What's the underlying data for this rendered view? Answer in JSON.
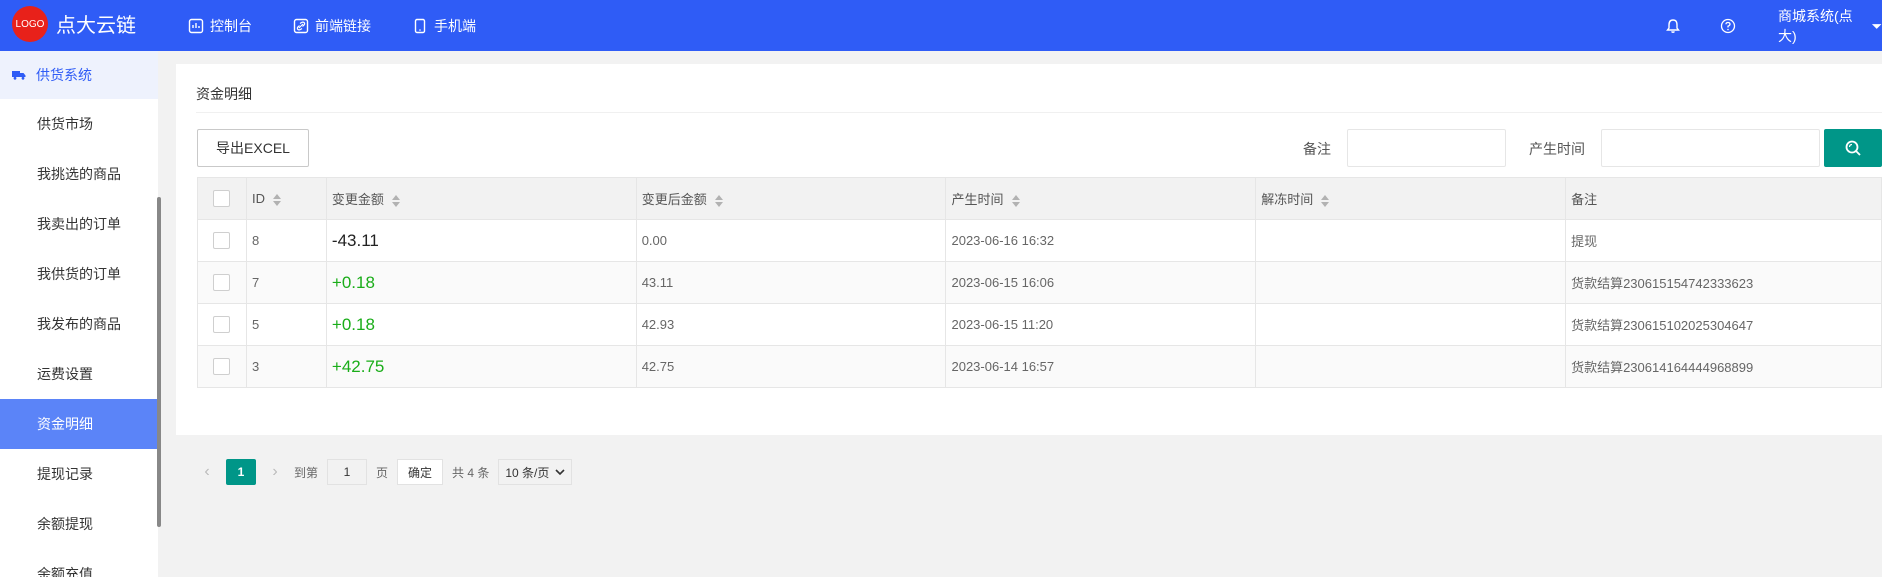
{
  "header": {
    "logo_text": "LOGO",
    "brand": "点大云链",
    "nav": [
      {
        "label": "控制台",
        "icon": "dashboard-icon"
      },
      {
        "label": "前端链接",
        "icon": "link-icon"
      },
      {
        "label": "手机端",
        "icon": "mobile-icon"
      }
    ],
    "user_label": "商城系统(点大)"
  },
  "sidebar": {
    "group_label": "供货系统",
    "items": [
      {
        "label": "供货市场"
      },
      {
        "label": "我挑选的商品"
      },
      {
        "label": "我卖出的订单"
      },
      {
        "label": "我供货的订单"
      },
      {
        "label": "我发布的商品"
      },
      {
        "label": "运费设置"
      },
      {
        "label": "资金明细",
        "active": true
      },
      {
        "label": "提现记录"
      },
      {
        "label": "余额提现"
      },
      {
        "label": "余额充值"
      }
    ]
  },
  "page": {
    "title": "资金明细",
    "export_label": "导出EXCEL",
    "filters": {
      "remark_label": "备注",
      "remark_value": "",
      "time_label": "产生时间",
      "time_value": ""
    }
  },
  "table": {
    "columns": [
      "ID",
      "变更金额",
      "变更后金额",
      "产生时间",
      "解冻时间",
      "备注"
    ],
    "rows": [
      {
        "id": "8",
        "change": "-43.11",
        "after": "0.00",
        "created": "2023-06-16 16:32",
        "unfreeze": "",
        "remark": "提现"
      },
      {
        "id": "7",
        "change": "+0.18",
        "after": "43.11",
        "created": "2023-06-15 16:06",
        "unfreeze": "",
        "remark": "货款结算230615154742333623"
      },
      {
        "id": "5",
        "change": "+0.18",
        "after": "42.93",
        "created": "2023-06-15 11:20",
        "unfreeze": "",
        "remark": "货款结算230615102025304647"
      },
      {
        "id": "3",
        "change": "+42.75",
        "after": "42.75",
        "created": "2023-06-14 16:57",
        "unfreeze": "",
        "remark": "货款结算230614164444968899"
      }
    ]
  },
  "pager": {
    "current": "1",
    "goto_label": "到第",
    "goto_value": "1",
    "page_unit": "页",
    "confirm_label": "确定",
    "total_label": "共 4 条",
    "page_size": "10 条/页"
  },
  "colors": {
    "header_bg": "#2f5cf6",
    "sidebar_active": "#5b84f8",
    "primary_green": "#009688",
    "positive_amount": "#1aad19"
  }
}
